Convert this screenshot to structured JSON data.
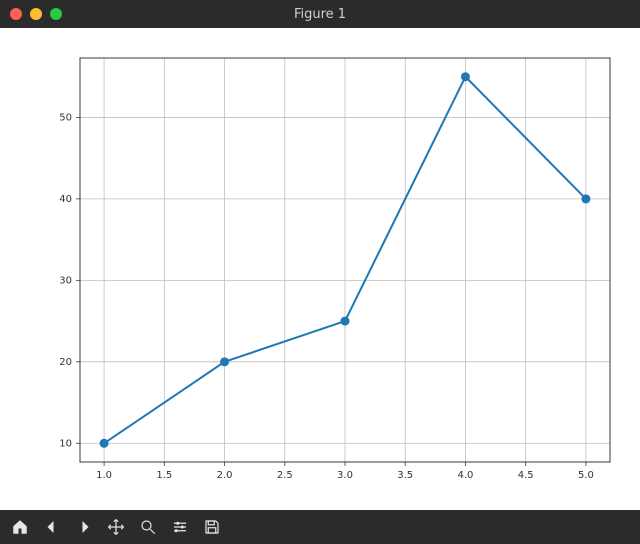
{
  "window": {
    "title": "Figure 1"
  },
  "toolbar": {
    "home": "Home",
    "back": "Back",
    "forward": "Forward",
    "pan": "Pan",
    "zoom": "Zoom",
    "config": "Configure subplots",
    "save": "Save"
  },
  "axis": {
    "x_ticks": [
      "1.0",
      "1.5",
      "2.0",
      "2.5",
      "3.0",
      "3.5",
      "4.0",
      "4.5",
      "5.0"
    ],
    "y_ticks": [
      "10",
      "20",
      "30",
      "40",
      "50"
    ]
  },
  "colors": {
    "line": "#1f77b4",
    "grid": "#bfbfbf",
    "spine": "#3a3a3a"
  },
  "chart_data": {
    "type": "line",
    "x": [
      1.0,
      2.0,
      3.0,
      4.0,
      5.0
    ],
    "values": [
      10,
      20,
      25,
      55,
      40
    ],
    "title": "",
    "xlabel": "",
    "ylabel": "",
    "xlim": [
      0.8,
      5.2
    ],
    "ylim": [
      7.7,
      57.3
    ],
    "grid": true,
    "markers": true
  }
}
